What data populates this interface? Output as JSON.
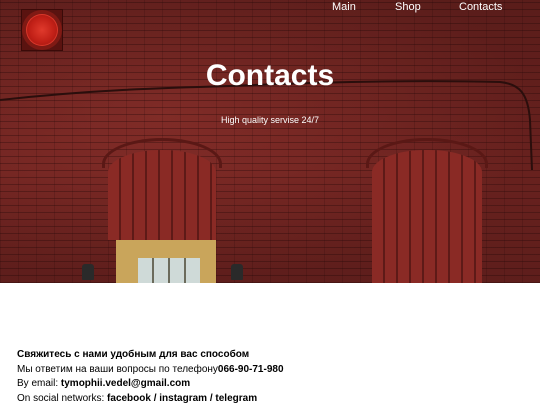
{
  "nav": {
    "main": "Main",
    "shop": "Shop",
    "contacts": "Contacts"
  },
  "hero": {
    "title": "Contacts",
    "subtitle": "High quality servise 24/7"
  },
  "contact_info": {
    "heading": "Свяжитесь с нами удобным для вас способом",
    "phone_prefix": "Мы ответим на ваши вопросы по телефону",
    "phone": "066-90-71-980",
    "email_prefix": "By email: ",
    "email": "tymophii.vedel@gmail.com",
    "social_prefix": "On social networks: ",
    "social_links": "facebook / instagram / telegram"
  },
  "colors": {
    "brick": "#7a2824",
    "logo_red": "#c01f16",
    "text": "#000000",
    "nav_text": "#ffffff"
  },
  "icons": {
    "logo": "red-circle-logo"
  }
}
